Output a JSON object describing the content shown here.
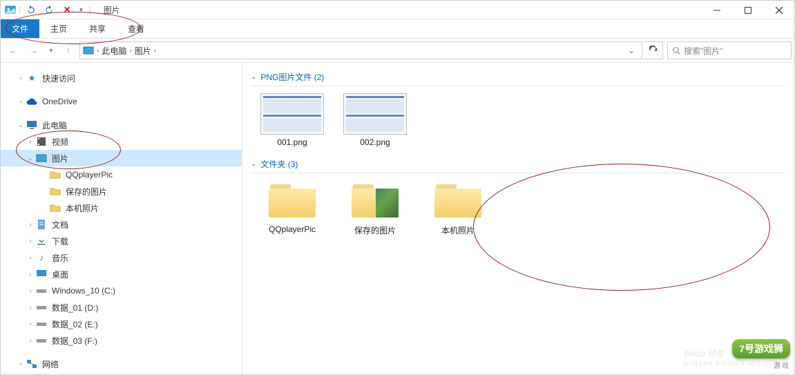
{
  "window": {
    "title": "图片"
  },
  "ribbon": {
    "file": "文件",
    "home": "主页",
    "share": "共享",
    "view": "查看"
  },
  "breadcrumb": {
    "root": "此电脑",
    "current": "图片"
  },
  "search": {
    "placeholder": "搜索\"图片\""
  },
  "sidebar": {
    "quickAccess": "快速访问",
    "onedrive": "OneDrive",
    "thisPC": "此电脑",
    "videos": "视频",
    "pictures": "图片",
    "pic_children": [
      "QQplayerPic",
      "保存的图片",
      "本机照片"
    ],
    "documents": "文档",
    "downloads": "下载",
    "music": "音乐",
    "desktop": "桌面",
    "drives": [
      "Windows_10 (C:)",
      "数据_01 (D:)",
      "数据_02 (E:)",
      "数据_03 (F:)"
    ],
    "network": "网络"
  },
  "content": {
    "group_png": "PNG图片文件 (2)",
    "group_folders": "文件夹 (3)",
    "png_files": [
      "001.png",
      "002.png"
    ],
    "folders": [
      "QQplayerPic",
      "保存的图片",
      "本机照片"
    ]
  },
  "watermarks": {
    "baidu": "Baidu 经验",
    "baidu_url": "jingyan.baidu.xiayx.com",
    "logo_main": "7号游戏狮",
    "logo_sub": "游戏"
  }
}
